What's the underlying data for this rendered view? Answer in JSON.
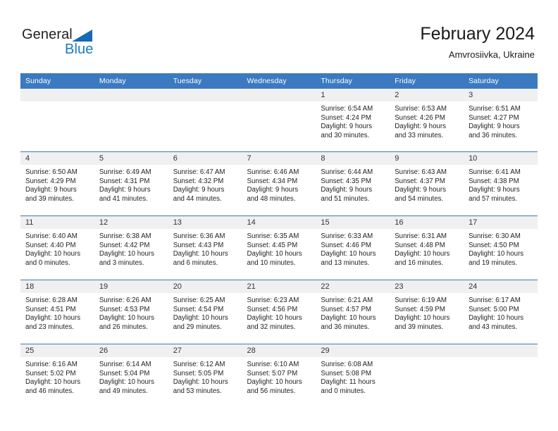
{
  "brand": {
    "name_part1": "General",
    "name_part2": "Blue",
    "triangle_icon": "triangle-icon",
    "accent_color": "#1a7ac4",
    "dark_color": "#231f20"
  },
  "header": {
    "title": "February 2024",
    "subtitle": "Amvrosiivka, Ukraine"
  },
  "theme": {
    "header_blue": "#3b7ac0",
    "daynum_band": "#f0f0f0",
    "text": "#1f1f1f"
  },
  "weekdays": [
    "Sunday",
    "Monday",
    "Tuesday",
    "Wednesday",
    "Thursday",
    "Friday",
    "Saturday"
  ],
  "weeks": [
    {
      "days": [
        {
          "date": "",
          "lines": []
        },
        {
          "date": "",
          "lines": []
        },
        {
          "date": "",
          "lines": []
        },
        {
          "date": "",
          "lines": []
        },
        {
          "date": "1",
          "lines": [
            "Sunrise: 6:54 AM",
            "Sunset: 4:24 PM",
            "Daylight: 9 hours",
            "and 30 minutes."
          ]
        },
        {
          "date": "2",
          "lines": [
            "Sunrise: 6:53 AM",
            "Sunset: 4:26 PM",
            "Daylight: 9 hours",
            "and 33 minutes."
          ]
        },
        {
          "date": "3",
          "lines": [
            "Sunrise: 6:51 AM",
            "Sunset: 4:27 PM",
            "Daylight: 9 hours",
            "and 36 minutes."
          ]
        }
      ]
    },
    {
      "days": [
        {
          "date": "4",
          "lines": [
            "Sunrise: 6:50 AM",
            "Sunset: 4:29 PM",
            "Daylight: 9 hours",
            "and 39 minutes."
          ]
        },
        {
          "date": "5",
          "lines": [
            "Sunrise: 6:49 AM",
            "Sunset: 4:31 PM",
            "Daylight: 9 hours",
            "and 41 minutes."
          ]
        },
        {
          "date": "6",
          "lines": [
            "Sunrise: 6:47 AM",
            "Sunset: 4:32 PM",
            "Daylight: 9 hours",
            "and 44 minutes."
          ]
        },
        {
          "date": "7",
          "lines": [
            "Sunrise: 6:46 AM",
            "Sunset: 4:34 PM",
            "Daylight: 9 hours",
            "and 48 minutes."
          ]
        },
        {
          "date": "8",
          "lines": [
            "Sunrise: 6:44 AM",
            "Sunset: 4:35 PM",
            "Daylight: 9 hours",
            "and 51 minutes."
          ]
        },
        {
          "date": "9",
          "lines": [
            "Sunrise: 6:43 AM",
            "Sunset: 4:37 PM",
            "Daylight: 9 hours",
            "and 54 minutes."
          ]
        },
        {
          "date": "10",
          "lines": [
            "Sunrise: 6:41 AM",
            "Sunset: 4:38 PM",
            "Daylight: 9 hours",
            "and 57 minutes."
          ]
        }
      ]
    },
    {
      "days": [
        {
          "date": "11",
          "lines": [
            "Sunrise: 6:40 AM",
            "Sunset: 4:40 PM",
            "Daylight: 10 hours",
            "and 0 minutes."
          ]
        },
        {
          "date": "12",
          "lines": [
            "Sunrise: 6:38 AM",
            "Sunset: 4:42 PM",
            "Daylight: 10 hours",
            "and 3 minutes."
          ]
        },
        {
          "date": "13",
          "lines": [
            "Sunrise: 6:36 AM",
            "Sunset: 4:43 PM",
            "Daylight: 10 hours",
            "and 6 minutes."
          ]
        },
        {
          "date": "14",
          "lines": [
            "Sunrise: 6:35 AM",
            "Sunset: 4:45 PM",
            "Daylight: 10 hours",
            "and 10 minutes."
          ]
        },
        {
          "date": "15",
          "lines": [
            "Sunrise: 6:33 AM",
            "Sunset: 4:46 PM",
            "Daylight: 10 hours",
            "and 13 minutes."
          ]
        },
        {
          "date": "16",
          "lines": [
            "Sunrise: 6:31 AM",
            "Sunset: 4:48 PM",
            "Daylight: 10 hours",
            "and 16 minutes."
          ]
        },
        {
          "date": "17",
          "lines": [
            "Sunrise: 6:30 AM",
            "Sunset: 4:50 PM",
            "Daylight: 10 hours",
            "and 19 minutes."
          ]
        }
      ]
    },
    {
      "days": [
        {
          "date": "18",
          "lines": [
            "Sunrise: 6:28 AM",
            "Sunset: 4:51 PM",
            "Daylight: 10 hours",
            "and 23 minutes."
          ]
        },
        {
          "date": "19",
          "lines": [
            "Sunrise: 6:26 AM",
            "Sunset: 4:53 PM",
            "Daylight: 10 hours",
            "and 26 minutes."
          ]
        },
        {
          "date": "20",
          "lines": [
            "Sunrise: 6:25 AM",
            "Sunset: 4:54 PM",
            "Daylight: 10 hours",
            "and 29 minutes."
          ]
        },
        {
          "date": "21",
          "lines": [
            "Sunrise: 6:23 AM",
            "Sunset: 4:56 PM",
            "Daylight: 10 hours",
            "and 32 minutes."
          ]
        },
        {
          "date": "22",
          "lines": [
            "Sunrise: 6:21 AM",
            "Sunset: 4:57 PM",
            "Daylight: 10 hours",
            "and 36 minutes."
          ]
        },
        {
          "date": "23",
          "lines": [
            "Sunrise: 6:19 AM",
            "Sunset: 4:59 PM",
            "Daylight: 10 hours",
            "and 39 minutes."
          ]
        },
        {
          "date": "24",
          "lines": [
            "Sunrise: 6:17 AM",
            "Sunset: 5:00 PM",
            "Daylight: 10 hours",
            "and 43 minutes."
          ]
        }
      ]
    },
    {
      "days": [
        {
          "date": "25",
          "lines": [
            "Sunrise: 6:16 AM",
            "Sunset: 5:02 PM",
            "Daylight: 10 hours",
            "and 46 minutes."
          ]
        },
        {
          "date": "26",
          "lines": [
            "Sunrise: 6:14 AM",
            "Sunset: 5:04 PM",
            "Daylight: 10 hours",
            "and 49 minutes."
          ]
        },
        {
          "date": "27",
          "lines": [
            "Sunrise: 6:12 AM",
            "Sunset: 5:05 PM",
            "Daylight: 10 hours",
            "and 53 minutes."
          ]
        },
        {
          "date": "28",
          "lines": [
            "Sunrise: 6:10 AM",
            "Sunset: 5:07 PM",
            "Daylight: 10 hours",
            "and 56 minutes."
          ]
        },
        {
          "date": "29",
          "lines": [
            "Sunrise: 6:08 AM",
            "Sunset: 5:08 PM",
            "Daylight: 11 hours",
            "and 0 minutes."
          ]
        },
        {
          "date": "",
          "lines": []
        },
        {
          "date": "",
          "lines": []
        }
      ]
    }
  ]
}
